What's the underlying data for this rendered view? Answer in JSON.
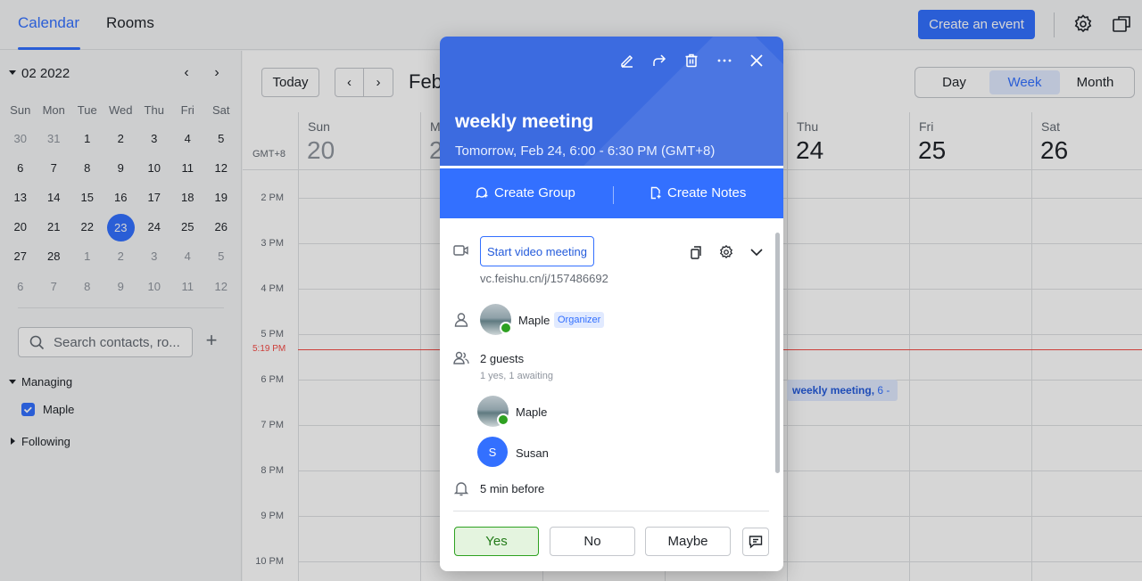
{
  "topbar": {
    "tabs": [
      "Calendar",
      "Rooms"
    ],
    "active_tab": "Calendar",
    "create_label": "Create an event",
    "icons": [
      "gear-icon",
      "window-icon"
    ]
  },
  "sidebar": {
    "mini_title": "02 2022",
    "weekdays": [
      "Sun",
      "Mon",
      "Tue",
      "Wed",
      "Thu",
      "Fri",
      "Sat"
    ],
    "weeks": [
      [
        "30",
        "31",
        "1",
        "2",
        "3",
        "4",
        "5"
      ],
      [
        "6",
        "7",
        "8",
        "9",
        "10",
        "11",
        "12"
      ],
      [
        "13",
        "14",
        "15",
        "16",
        "17",
        "18",
        "19"
      ],
      [
        "20",
        "21",
        "22",
        "23",
        "24",
        "25",
        "26"
      ],
      [
        "27",
        "28",
        "1",
        "2",
        "3",
        "4",
        "5"
      ],
      [
        "6",
        "7",
        "8",
        "9",
        "10",
        "11",
        "12"
      ]
    ],
    "selected_day": "23",
    "search_placeholder": "Search contacts, ro...",
    "managing_label": "Managing",
    "calendar_item": "Maple",
    "following_label": "Following"
  },
  "main": {
    "today_label": "Today",
    "month_label": "Feb",
    "views": [
      "Day",
      "Week",
      "Month"
    ],
    "selected_view": "Week",
    "timezone": "GMT+8",
    "days": [
      {
        "name": "Sun",
        "num": "20"
      },
      {
        "name": "M",
        "num": "2"
      },
      {
        "name": "",
        "num": ""
      },
      {
        "name": "",
        "num": ""
      },
      {
        "name": "Thu",
        "num": "24"
      },
      {
        "name": "Fri",
        "num": "25"
      },
      {
        "name": "Sat",
        "num": "26"
      }
    ],
    "hours": [
      "2 PM",
      "3 PM",
      "4 PM",
      "5 PM",
      "6 PM",
      "7 PM",
      "8 PM",
      "9 PM",
      "10 PM"
    ],
    "now_label": "5:19 PM",
    "event_chip": {
      "title": "weekly meeting,",
      "time": "6 -"
    }
  },
  "popup": {
    "title": "weekly meeting",
    "time": "Tomorrow, Feb 24, 6:00 - 6:30 PM (GMT+8)",
    "create_group": "Create Group",
    "create_notes": "Create Notes",
    "video_button": "Start video meeting",
    "vc_link": "vc.feishu.cn/j/157486692",
    "organizer_name": "Maple",
    "organizer_tag": "Organizer",
    "guests_count": "2 guests",
    "guests_status": "1 yes, 1 awaiting",
    "guests": [
      {
        "name": "Maple",
        "initial": ""
      },
      {
        "name": "Susan",
        "initial": "S"
      }
    ],
    "reminder": "5 min before",
    "rsvp": [
      "Yes",
      "No",
      "Maybe"
    ],
    "header_color": "#3c6be0",
    "accent": "#3370ff"
  }
}
